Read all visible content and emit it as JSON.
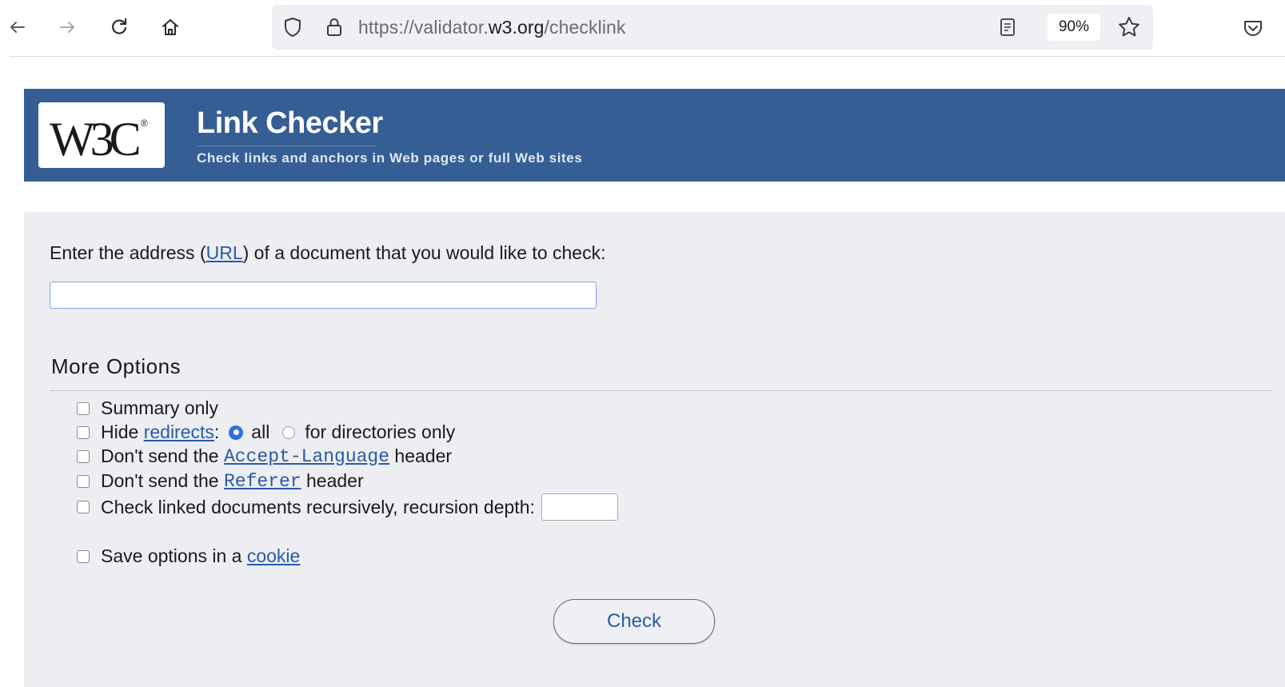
{
  "browser": {
    "url_prefix": "https://validator.",
    "url_domain": "w3.org",
    "url_path": "/checklink",
    "zoom": "90%",
    "icons": [
      "back-arrow-icon",
      "forward-arrow-icon",
      "reload-icon",
      "home-icon",
      "shield-icon",
      "lock-icon",
      "reader-view-icon",
      "star-icon",
      "pocket-icon"
    ]
  },
  "banner": {
    "logo": "W3C",
    "title": "Link Checker",
    "subtitle": "Check links and anchors in Web pages or full Web sites",
    "background": "#355f94"
  },
  "form": {
    "prompt_before": "Enter the address (",
    "prompt_link": "URL",
    "prompt_after": ") of a document that you would like to check:",
    "url_value": "",
    "more_options_title": "More Options",
    "options": {
      "summary_only": "Summary only",
      "hide_prefix": "Hide ",
      "hide_link": "redirects",
      "hide_colon": ":",
      "radio_all": "all",
      "radio_dirs": "for directories only",
      "accept_lang_prefix": "Don't send the ",
      "accept_lang_code": "Accept-Language",
      "accept_lang_suffix": " header",
      "referer_prefix": "Don't send the ",
      "referer_code": "Referer",
      "referer_suffix": " header",
      "recursive_label": "Check linked documents recursively, recursion depth:",
      "recursion_depth_value": "",
      "cookie_prefix": "Save options in a ",
      "cookie_link": "cookie"
    },
    "check_button": "Check",
    "link_color": "#2a5aa8"
  }
}
